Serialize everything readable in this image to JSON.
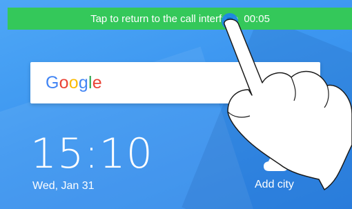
{
  "call_bar": {
    "text": "Tap to return to the call interface",
    "timer": "00:05",
    "color": "#34c85a"
  },
  "search_widget": {
    "logo_letters": [
      {
        "char": "G",
        "color": "#4285f4"
      },
      {
        "char": "o",
        "color": "#ea4335"
      },
      {
        "char": "o",
        "color": "#fbbc05"
      },
      {
        "char": "g",
        "color": "#4285f4"
      },
      {
        "char": "l",
        "color": "#34a853"
      },
      {
        "char": "e",
        "color": "#ea4335"
      }
    ]
  },
  "clock_widget": {
    "time": "15:10",
    "date": "Wed, Jan 31"
  },
  "weather_widget": {
    "icon": "cloud-icon",
    "label": "Add city"
  },
  "gesture": {
    "icon": "hand-pointer-icon",
    "tap_indicator_color": "#1e88e5"
  }
}
